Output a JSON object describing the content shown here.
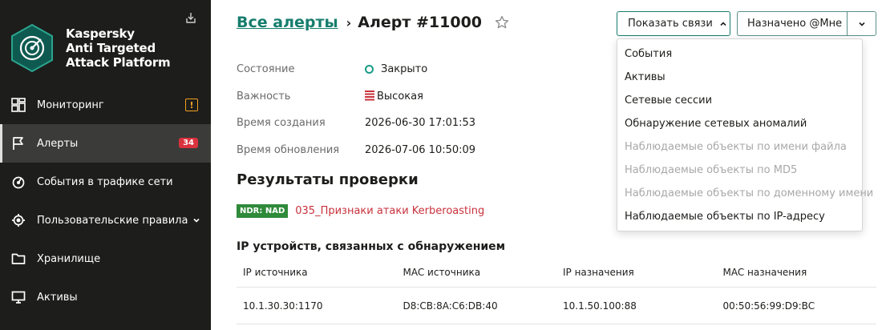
{
  "brand": {
    "line1": "Kaspersky",
    "line2": "Anti Targeted",
    "line3": "Attack Platform"
  },
  "nav": {
    "items": [
      {
        "label": "Мониторинг",
        "icon": "dashboard-icon"
      },
      {
        "label": "Алерты",
        "icon": "flag-icon",
        "badge": "34"
      },
      {
        "label": "События в трафике сети",
        "icon": "traffic-icon"
      },
      {
        "label": "Пользовательские правила",
        "icon": "rules-icon"
      },
      {
        "label": "Хранилище",
        "icon": "folder-icon"
      },
      {
        "label": "Активы",
        "icon": "monitor-icon"
      }
    ],
    "warning_badge": "!"
  },
  "header": {
    "breadcrumb_link": "Все алерты",
    "separator": "›",
    "title": "Алерт #11000",
    "show_links_label": "Показать связи",
    "assigned_label": "Назначено @Мне"
  },
  "props": [
    {
      "key": "Состояние",
      "value": "Закрыто"
    },
    {
      "key": "Важность",
      "value": "Высокая"
    },
    {
      "key": "Время создания",
      "value": "2026-06-30 17:01:53"
    },
    {
      "key": "Время обновления",
      "value": "2026-07-06 10:50:09"
    }
  ],
  "results": {
    "title": "Результаты проверки",
    "tag": "NDR: NAD",
    "detection": "035_Признаки атаки Kerberoasting"
  },
  "devices": {
    "title": "IP устройств, связанных с обнаружением",
    "headers": [
      "IP источника",
      "MAC источника",
      "IP назначения",
      "MAC назначения"
    ],
    "rows": [
      [
        "10.1.30.30:1170",
        "D8:CB:8A:C6:DB:40",
        "10.1.50.100:88",
        "00:50:56:99:D9:BC"
      ]
    ]
  },
  "dropdown": {
    "items": [
      {
        "label": "События",
        "enabled": true
      },
      {
        "label": "Активы",
        "enabled": true
      },
      {
        "label": "Сетевые сессии",
        "enabled": true
      },
      {
        "label": "Обнаружение сетевых аномалий",
        "enabled": true
      },
      {
        "label": "Наблюдаемые объекты по имени файла",
        "enabled": false
      },
      {
        "label": "Наблюдаемые объекты по MD5",
        "enabled": false
      },
      {
        "label": "Наблюдаемые объекты по доменному имени",
        "enabled": false
      },
      {
        "label": "Наблюдаемые объекты по IP-адресу",
        "enabled": true
      }
    ]
  },
  "colors": {
    "sidebar_bg": "#1d1d1b",
    "accent": "#167d6d",
    "status_closed": "#1a9b87",
    "severity_high": "#c8323c",
    "alert_badge": "#d9333f",
    "warning": "#f0a020",
    "ndr_tag": "#2f8a3a"
  }
}
